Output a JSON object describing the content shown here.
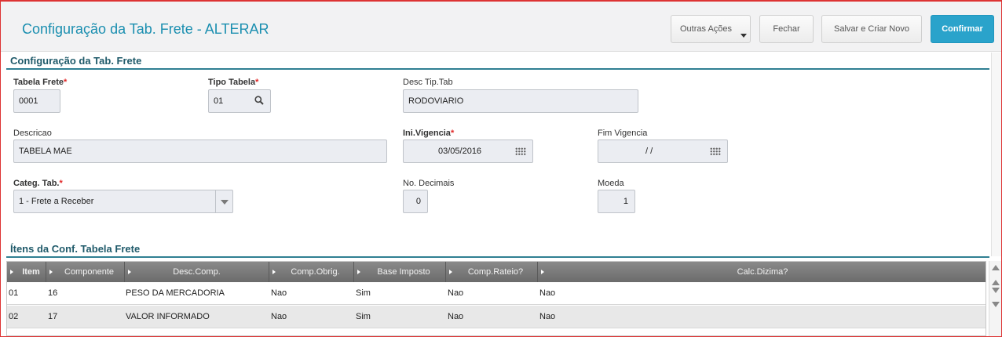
{
  "header": {
    "title": "Configuração da Tab. Frete - ALTERAR",
    "buttons": {
      "outras_acoes": "Outras Ações",
      "fechar": "Fechar",
      "salvar_criar": "Salvar e Criar Novo",
      "confirmar": "Confirmar"
    }
  },
  "form": {
    "section_title": "Configuração da Tab. Frete",
    "tabela_frete": {
      "label": "Tabela Frete",
      "value": "0001"
    },
    "tipo_tabela": {
      "label": "Tipo Tabela",
      "value": "01"
    },
    "desc_tip_tab": {
      "label": "Desc Tip.Tab",
      "value": "RODOVIARIO"
    },
    "descricao": {
      "label": "Descricao",
      "value": "TABELA MAE"
    },
    "ini_vigencia": {
      "label": "Ini.Vigencia",
      "value": "03/05/2016"
    },
    "fim_vigencia": {
      "label": "Fim Vigencia",
      "value": "/  /"
    },
    "categ_tab": {
      "label": "Categ. Tab.",
      "value": "1 - Frete a Receber"
    },
    "no_decimais": {
      "label": "No. Decimais",
      "value": "0"
    },
    "moeda": {
      "label": "Moeda",
      "value": "1"
    },
    "required_mark": "*"
  },
  "grid": {
    "section_title": "Ítens da Conf. Tabela Frete",
    "columns": [
      "Item",
      "Componente",
      "Desc.Comp.",
      "Comp.Obrig.",
      "Base Imposto",
      "Comp.Rateio?",
      "Calc.Dizima?"
    ],
    "rows": [
      [
        "01",
        "16",
        "PESO DA MERCADORIA",
        "Nao",
        "Sim",
        "Nao",
        "Nao"
      ],
      [
        "02",
        "17",
        "VALOR INFORMADO",
        "Nao",
        "Sim",
        "Nao",
        "Nao"
      ]
    ]
  },
  "icons": {
    "search": "search-icon",
    "calendar": "calendar-icon",
    "dropdown": "chevron-down-icon"
  },
  "colors": {
    "accent": "#1b8fb0",
    "confirm": "#2aa3cb",
    "required": "#e02424"
  }
}
